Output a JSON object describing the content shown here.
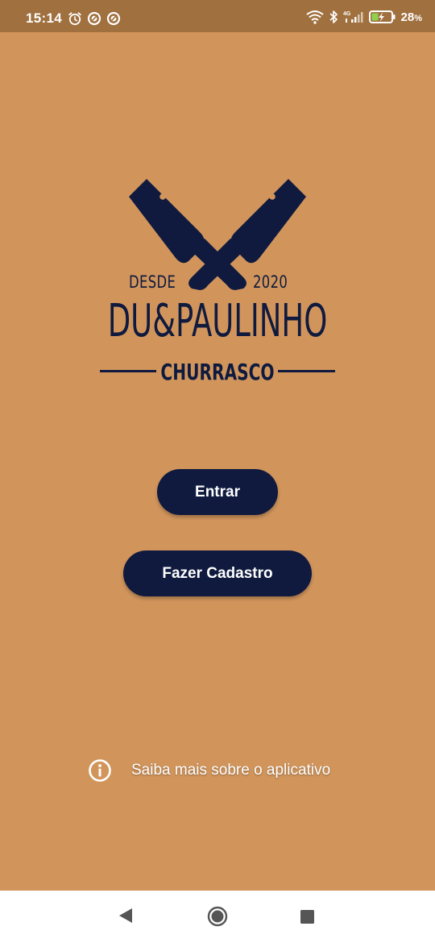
{
  "status_bar": {
    "time": "15:14",
    "left_icons": [
      "alarm-icon",
      "data-saver-icon",
      "data-saver-icon"
    ],
    "network": "4G",
    "battery_percent": "28",
    "battery_suffix": "%",
    "right_icons": [
      "wifi-icon",
      "bluetooth-icon",
      "signal-icon",
      "battery-charging-icon"
    ]
  },
  "logo": {
    "since_label": "DESDE",
    "since_year": "2020",
    "brand": "DU&PAULINHO",
    "subtitle": "CHURRASCO",
    "icon": "crossed-cleavers-icon"
  },
  "actions": {
    "login_label": "Entrar",
    "signup_label": "Fazer Cadastro"
  },
  "info": {
    "label": "Saiba mais sobre o aplicativo",
    "icon": "info-icon"
  },
  "navigation": {
    "back_icon": "back-icon",
    "home_icon": "home-icon",
    "recent_icon": "recent-apps-icon"
  },
  "colors": {
    "background": "#d1955c",
    "status_bar": "#a0703f",
    "primary": "#0f1a3e",
    "text_on_primary": "#ffffff",
    "nav_bar": "#ffffff"
  }
}
